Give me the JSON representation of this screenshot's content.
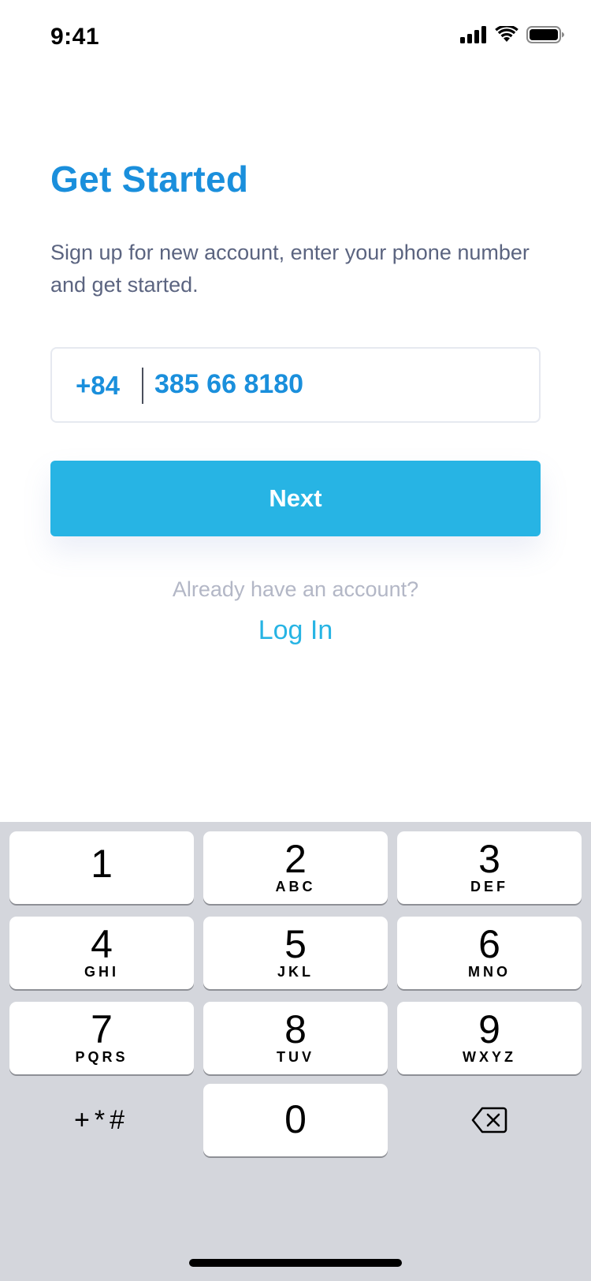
{
  "status_bar": {
    "time": "9:41",
    "icons": [
      "signal-icon",
      "wifi-icon",
      "battery-icon"
    ]
  },
  "signup": {
    "title": "Get Started",
    "subtitle": "Sign up for new account, enter your phone number and get started.",
    "country_code": "+84",
    "phone_number": "385 66 8180",
    "next_label": "Next",
    "already_text": "Already have an account?",
    "login_label": "Log In"
  },
  "keypad": {
    "keys": [
      {
        "digit": "1",
        "letters": ""
      },
      {
        "digit": "2",
        "letters": "ABC"
      },
      {
        "digit": "3",
        "letters": "DEF"
      },
      {
        "digit": "4",
        "letters": "GHI"
      },
      {
        "digit": "5",
        "letters": "JKL"
      },
      {
        "digit": "6",
        "letters": "MNO"
      },
      {
        "digit": "7",
        "letters": "PQRS"
      },
      {
        "digit": "8",
        "letters": "TUV"
      },
      {
        "digit": "9",
        "letters": "WXYZ"
      },
      {
        "digit": "0",
        "letters": ""
      }
    ],
    "symbols_label": "+*#",
    "delete_icon": "backspace-icon"
  },
  "colors": {
    "title": "#1a8fdc",
    "button": "#27b4e4",
    "subtitle": "#5b6480",
    "muted": "#b3b7c6",
    "keyboard_bg": "#d4d6dc"
  }
}
